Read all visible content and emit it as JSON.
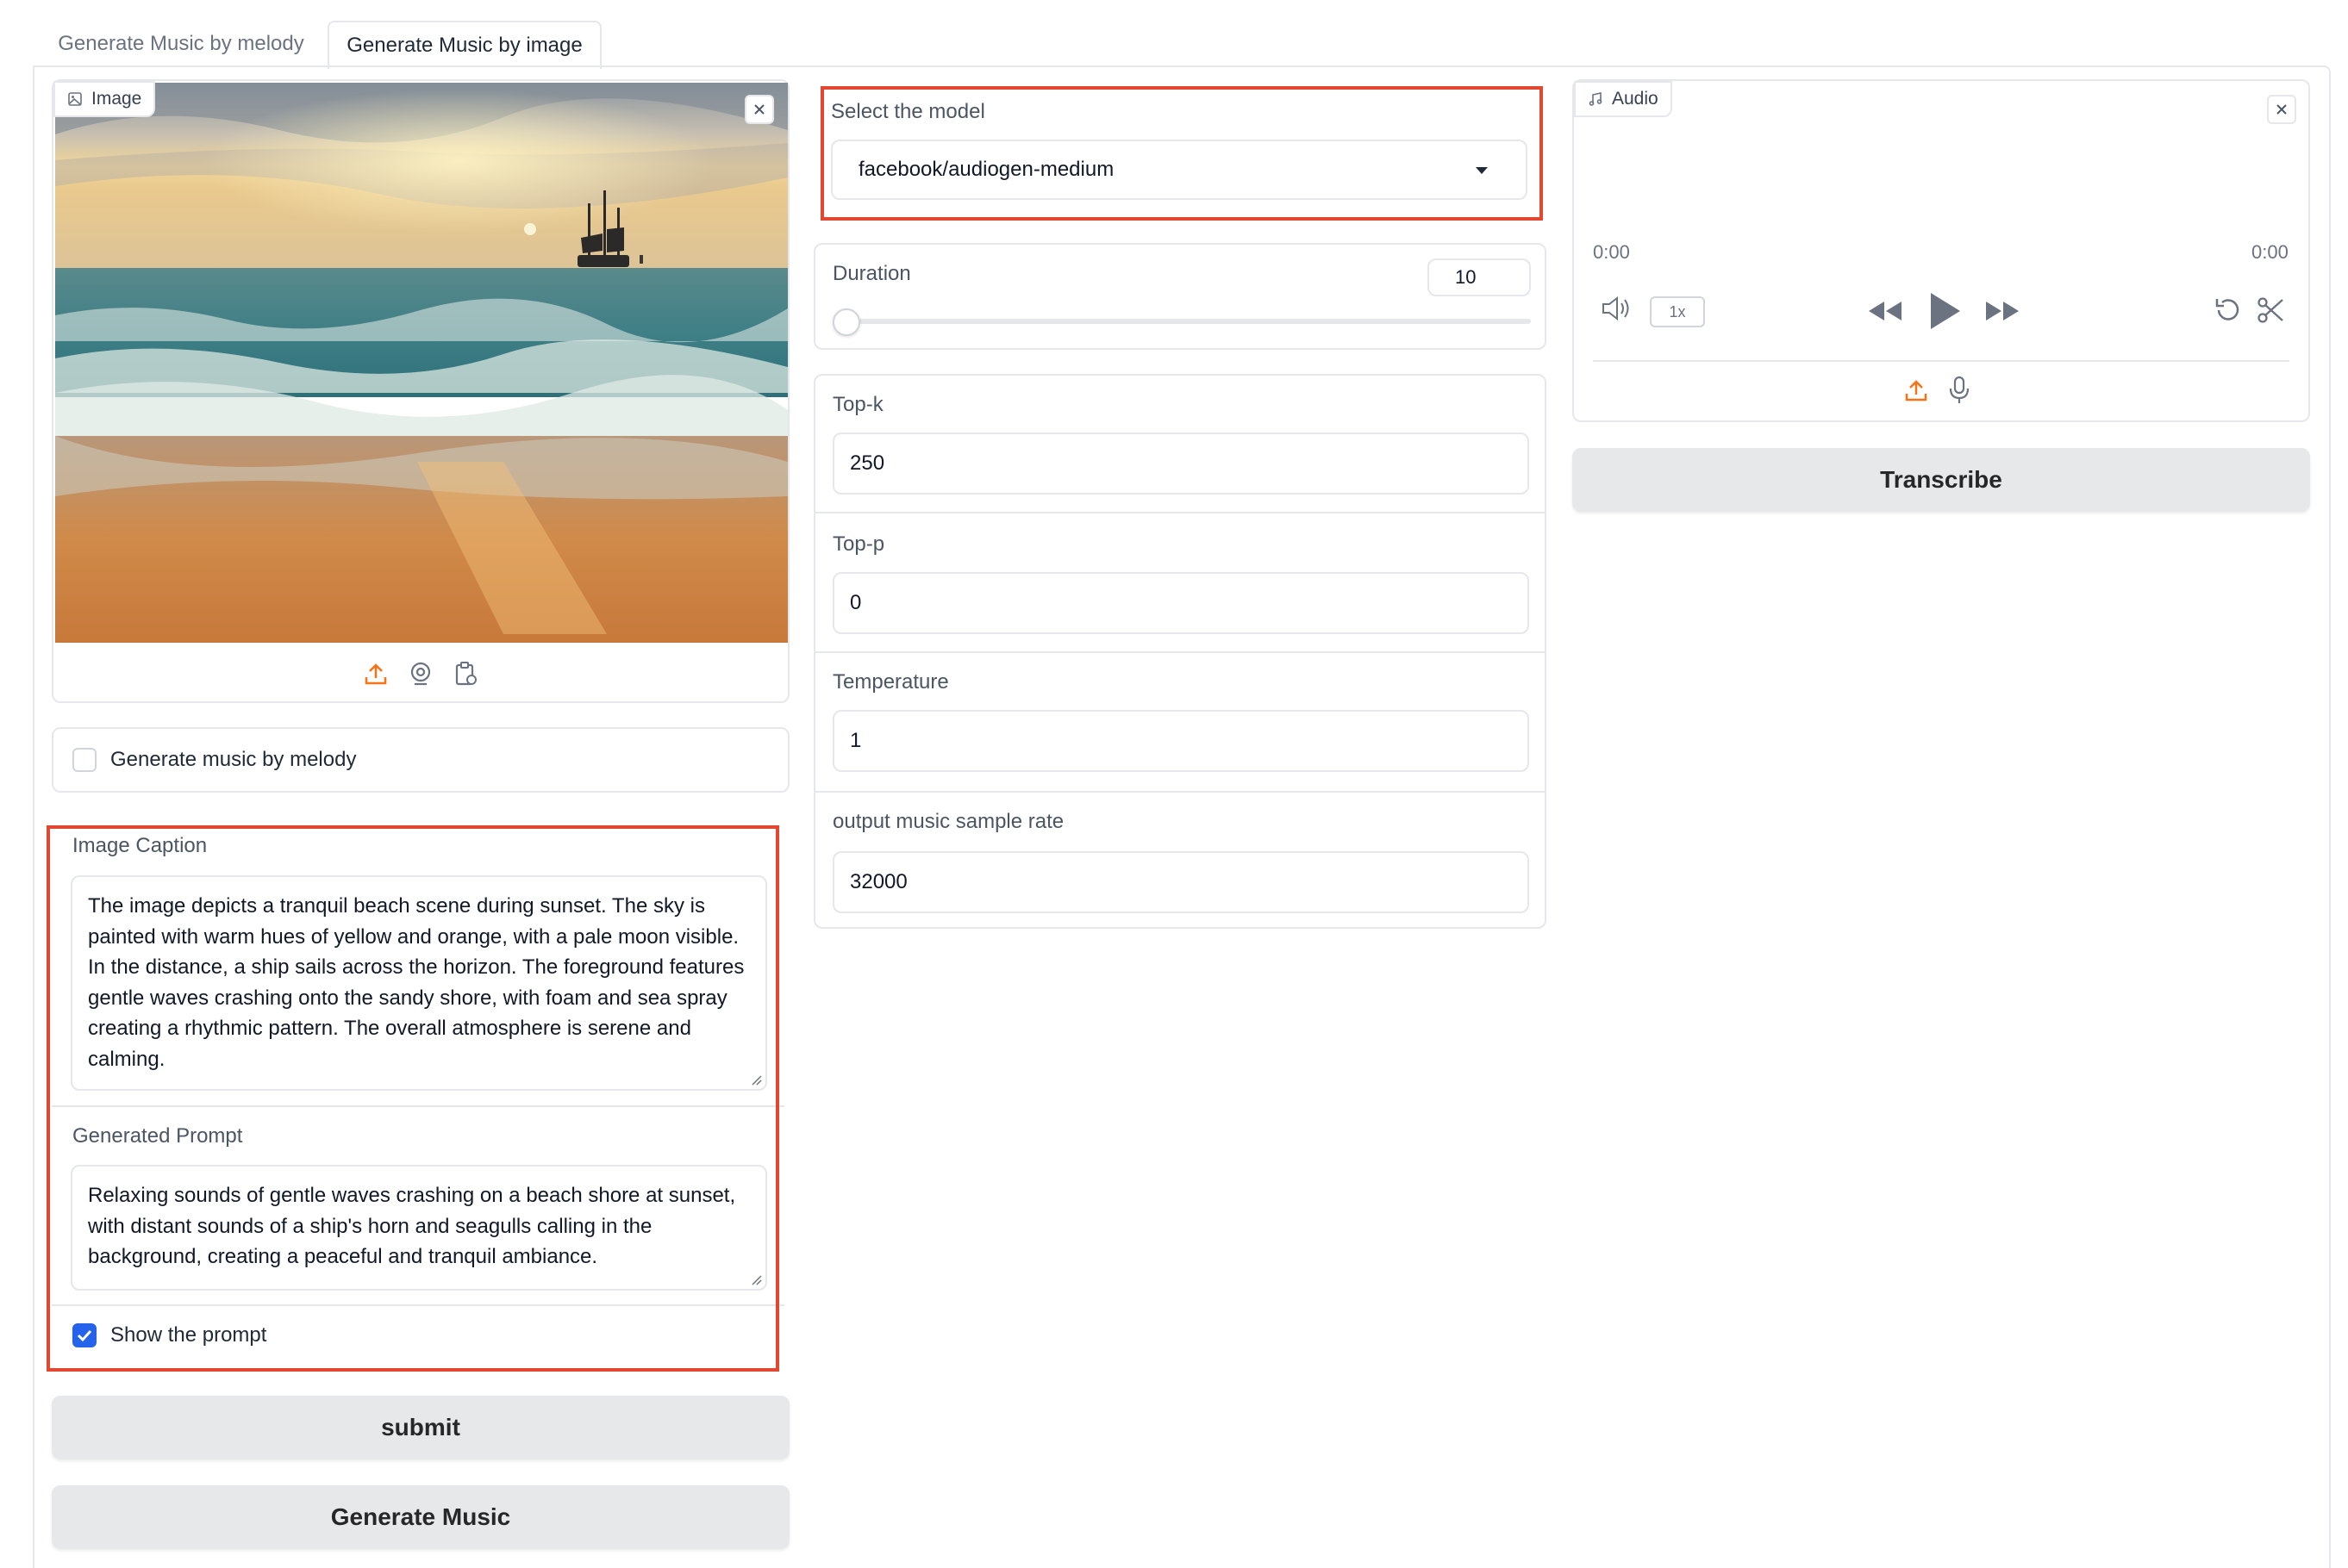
{
  "tabs": [
    {
      "label": "Generate Music by melody",
      "active": false
    },
    {
      "label": "Generate Music by image",
      "active": true
    }
  ],
  "image_panel": {
    "label": "Image",
    "icons": [
      "upload-icon",
      "webcam-icon",
      "clipboard-icon"
    ]
  },
  "melody_checkbox": {
    "label": "Generate music by melody",
    "checked": false
  },
  "caption": {
    "label": "Image Caption",
    "lines": [
      "The image depicts a tranquil beach scene during sunset. The sky is",
      "painted with warm hues of yellow and orange, with a pale moon visible.",
      "In the distance, a ship sails across the horizon. The foreground features",
      "gentle waves crashing onto the sandy shore, with foam and sea spray",
      "creating a rhythmic pattern. The overall atmosphere is serene and",
      "calming."
    ]
  },
  "prompt": {
    "label": "Generated Prompt",
    "lines": [
      "Relaxing sounds of gentle waves crashing on a beach shore at sunset,",
      "with distant sounds of a ship's horn and seagulls calling in the",
      "background, creating a peaceful and tranquil ambiance."
    ]
  },
  "show_prompt": {
    "label": "Show the prompt",
    "checked": true
  },
  "buttons": {
    "submit": "submit",
    "generate": "Generate Music",
    "transcribe": "Transcribe"
  },
  "model": {
    "label": "Select the model",
    "value": "facebook/audiogen-medium"
  },
  "duration": {
    "label": "Duration",
    "value": "10",
    "slider_fraction": 0.0
  },
  "topk": {
    "label": "Top-k",
    "value": "250"
  },
  "topp": {
    "label": "Top-p",
    "value": "0"
  },
  "temperature": {
    "label": "Temperature",
    "value": "1"
  },
  "sample_rate": {
    "label": "output music sample rate",
    "value": "32000"
  },
  "audio": {
    "label": "Audio",
    "time_start": "0:00",
    "time_end": "0:00",
    "speed": "1x"
  },
  "colors": {
    "accent_red": "#e3472f",
    "accent_orange": "#f97316",
    "check_blue": "#2563eb"
  }
}
